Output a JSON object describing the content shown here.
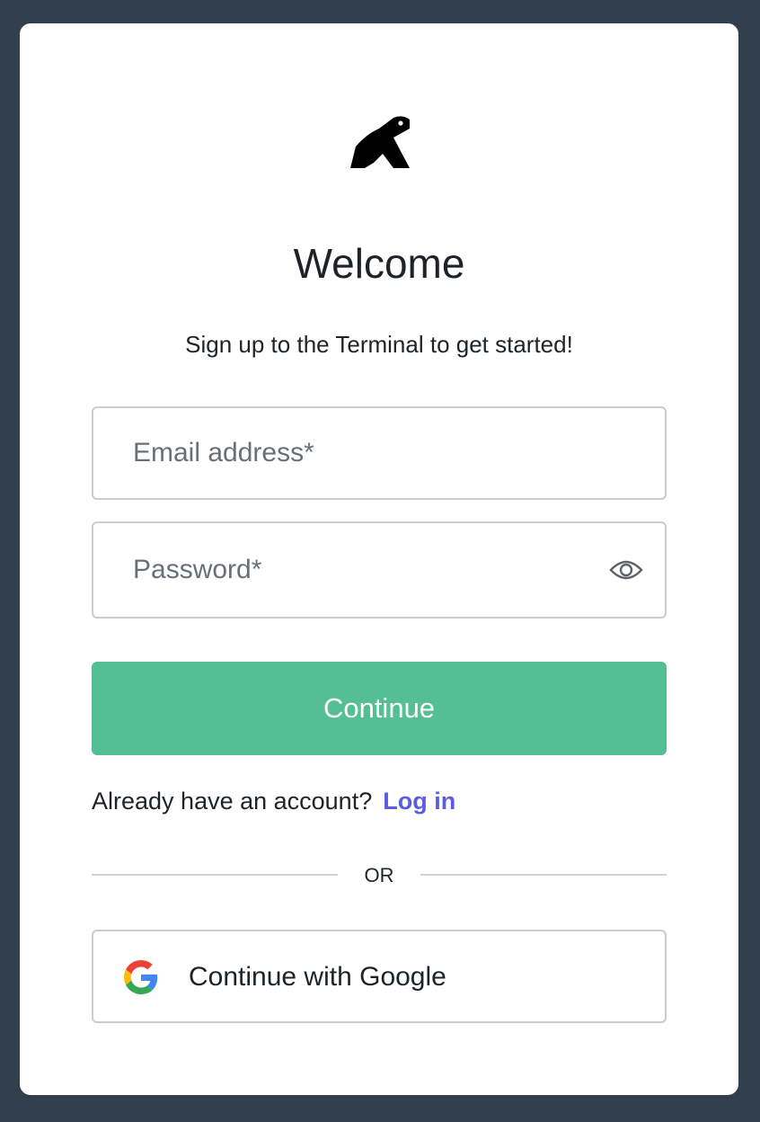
{
  "header": {
    "logo_icon": "frog-icon",
    "title": "Welcome",
    "subtitle": "Sign up to the Terminal to get started!"
  },
  "form": {
    "email_placeholder": "Email address*",
    "email_value": "",
    "password_placeholder": "Password*",
    "password_value": "",
    "show_password_icon": "eye-icon",
    "continue_label": "Continue"
  },
  "login": {
    "prompt": "Already have an account?",
    "link_label": "Log in"
  },
  "divider": {
    "label": "OR"
  },
  "social": {
    "google_icon": "google-icon",
    "google_label": "Continue with Google"
  },
  "colors": {
    "background": "#323f4d",
    "card": "#ffffff",
    "primary_button": "#54bf95",
    "link": "#5b5ce2"
  }
}
